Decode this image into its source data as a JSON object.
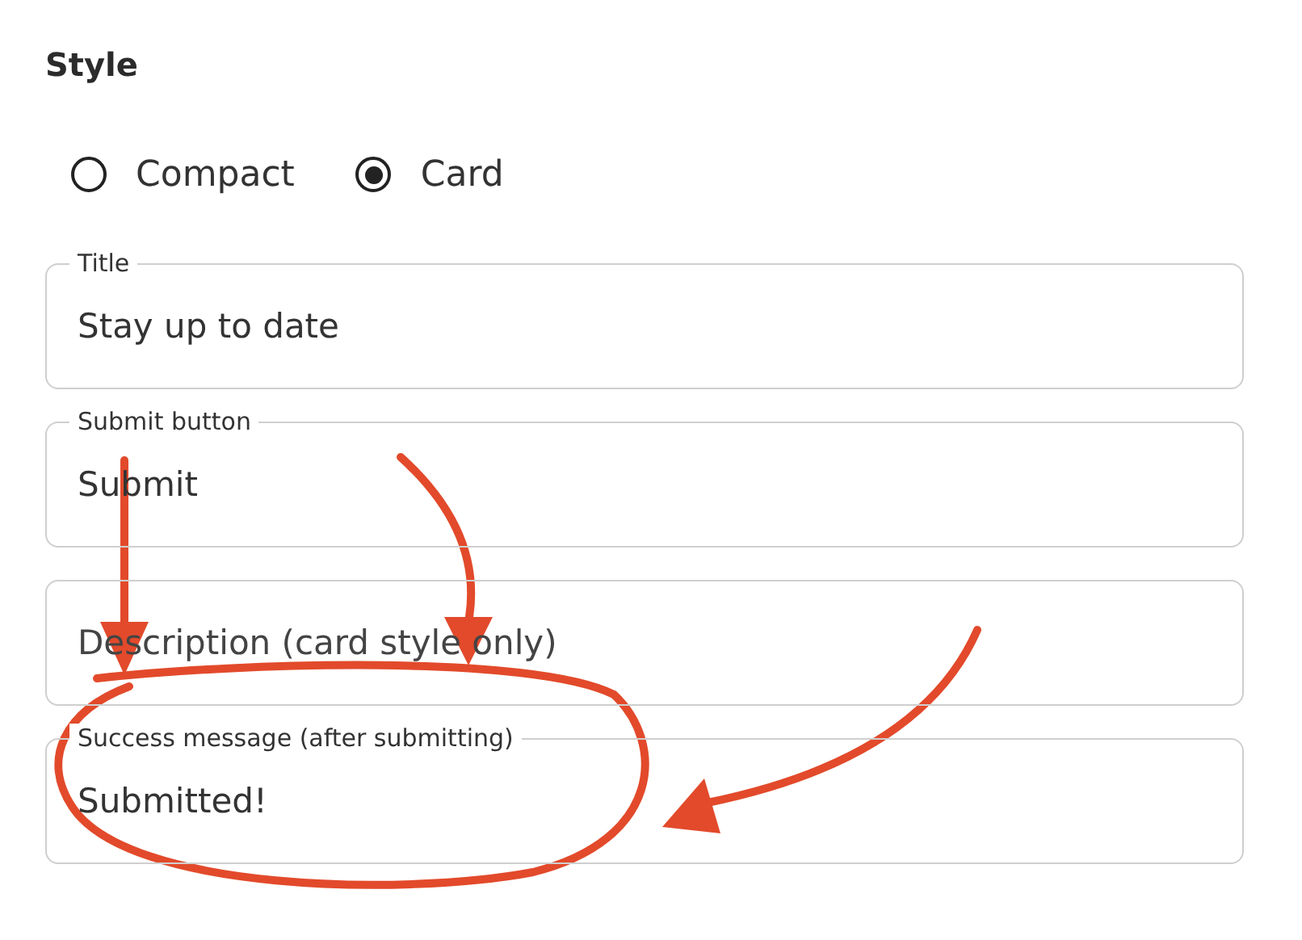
{
  "section_title": "Style",
  "style_options": [
    {
      "label": "Compact",
      "selected": false
    },
    {
      "label": "Card",
      "selected": true
    }
  ],
  "fields": [
    {
      "label": "Title",
      "value": "Stay up to date"
    },
    {
      "label": "Submit button",
      "value": "Submit"
    },
    {
      "placeholder": "Description (card style only)"
    },
    {
      "label": "Success message (after submitting)",
      "value": "Submitted!"
    }
  ]
}
